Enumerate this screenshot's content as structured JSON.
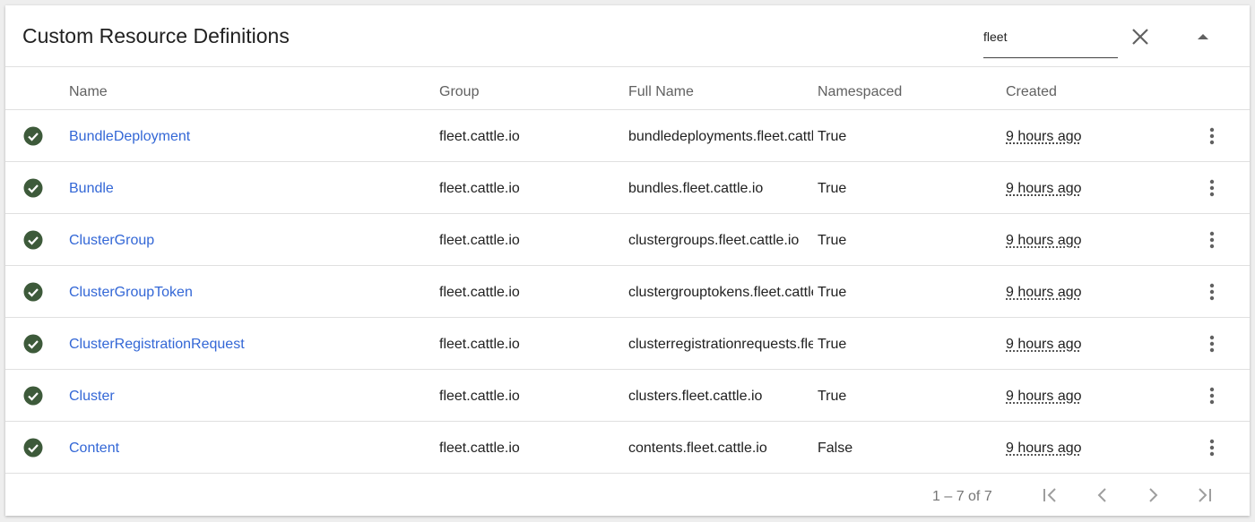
{
  "header": {
    "title": "Custom Resource Definitions",
    "search_value": "fleet",
    "clear_icon": "close-icon",
    "collapse_icon": "caret-up-icon"
  },
  "columns": {
    "name": "Name",
    "group": "Group",
    "full_name": "Full Name",
    "namespaced": "Namespaced",
    "created": "Created"
  },
  "rows": [
    {
      "name": "BundleDeployment",
      "group": "fleet.cattle.io",
      "full_name": "bundledeployments.fleet.cattle.io",
      "namespaced": "True",
      "created": "9 hours ago"
    },
    {
      "name": "Bundle",
      "group": "fleet.cattle.io",
      "full_name": "bundles.fleet.cattle.io",
      "namespaced": "True",
      "created": "9 hours ago"
    },
    {
      "name": "ClusterGroup",
      "group": "fleet.cattle.io",
      "full_name": "clustergroups.fleet.cattle.io",
      "namespaced": "True",
      "created": "9 hours ago"
    },
    {
      "name": "ClusterGroupToken",
      "group": "fleet.cattle.io",
      "full_name": "clustergrouptokens.fleet.cattle.io",
      "namespaced": "True",
      "created": "9 hours ago"
    },
    {
      "name": "ClusterRegistrationRequest",
      "group": "fleet.cattle.io",
      "full_name": "clusterregistrationrequests.fleet.cattle.io",
      "namespaced": "True",
      "created": "9 hours ago"
    },
    {
      "name": "Cluster",
      "group": "fleet.cattle.io",
      "full_name": "clusters.fleet.cattle.io",
      "namespaced": "True",
      "created": "9 hours ago"
    },
    {
      "name": "Content",
      "group": "fleet.cattle.io",
      "full_name": "contents.fleet.cattle.io",
      "namespaced": "False",
      "created": "9 hours ago"
    }
  ],
  "status_icon": "check-circle-icon",
  "status_color": "#3d5a3a",
  "link_color": "#3367d6",
  "footer": {
    "range": "1 – 7 of 7",
    "icons": [
      "first-page-icon",
      "previous-page-icon",
      "next-page-icon",
      "last-page-icon"
    ]
  }
}
